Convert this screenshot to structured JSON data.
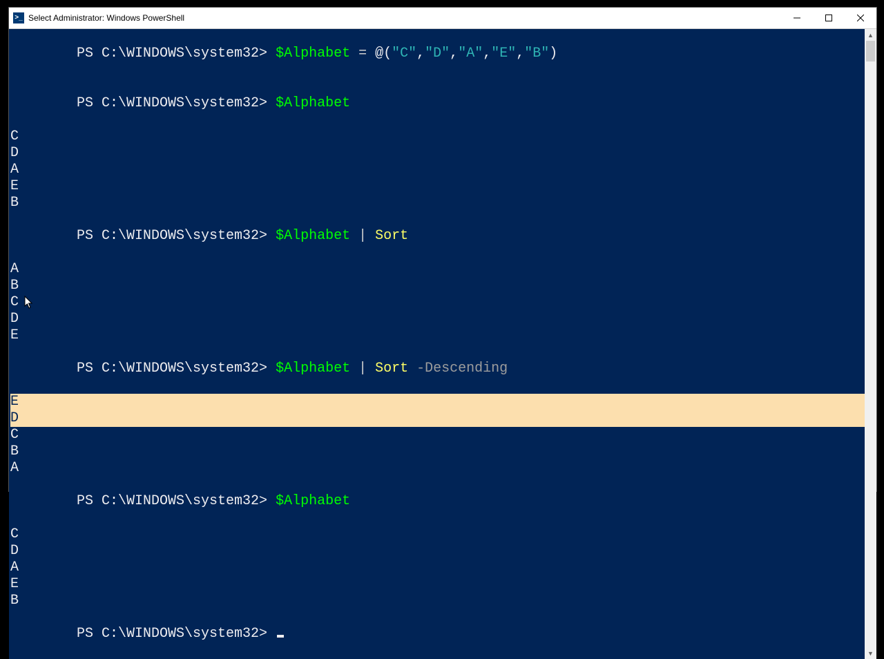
{
  "window": {
    "title": "Select Administrator: Windows PowerShell",
    "icon_glyph": ">_"
  },
  "colors": {
    "background": "#012456",
    "selection": "#fcdfae",
    "variable": "#00ff00",
    "command": "#ffff66",
    "string": "#2fb5b5",
    "param": "#9d9d9d",
    "text": "#eeedf0"
  },
  "prompt": "PS C:\\WINDOWS\\system32> ",
  "session": {
    "line1": {
      "var": "$Alphabet",
      "eq": " = ",
      "open": "@(",
      "s1": "\"C\"",
      "c1": ",",
      "s2": "\"D\"",
      "c2": ",",
      "s3": "\"A\"",
      "c3": ",",
      "s4": "\"E\"",
      "c4": ",",
      "s5": "\"B\"",
      "close": ")"
    },
    "line2": {
      "var": "$Alphabet"
    },
    "out2": [
      "C",
      "D",
      "A",
      "E",
      "B"
    ],
    "line3": {
      "var": "$Alphabet",
      "pipe": " | ",
      "cmd": "Sort"
    },
    "out3": [
      "A",
      "B",
      "C",
      "D",
      "E"
    ],
    "line4": {
      "var": "$Alphabet",
      "pipe": " | ",
      "cmd": "Sort",
      "sp": " ",
      "param": "-Descending"
    },
    "out4": [
      "E",
      "D",
      "C",
      "B",
      "A"
    ],
    "line5": {
      "var": "$Alphabet"
    },
    "out5": [
      "C",
      "D",
      "A",
      "E",
      "B"
    ]
  }
}
